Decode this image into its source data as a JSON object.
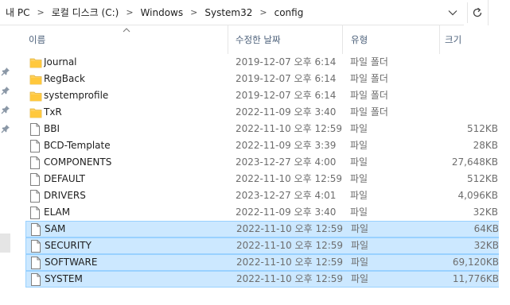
{
  "address_bar": {
    "crumbs": [
      "내 PC",
      "로컬 디스크 (C:)",
      "Windows",
      "System32",
      "config"
    ],
    "separator": ">"
  },
  "columns": {
    "name": "이름",
    "date": "수정한 날짜",
    "type": "유형",
    "size": "크기"
  },
  "rows": [
    {
      "name": "Journal",
      "date": "2019-12-07 오후 6:14",
      "type": "파일 폴더",
      "size": "",
      "icon": "folder-icon",
      "selected": false
    },
    {
      "name": "RegBack",
      "date": "2019-12-07 오후 6:14",
      "type": "파일 폴더",
      "size": "",
      "icon": "folder-icon",
      "selected": false
    },
    {
      "name": "systemprofile",
      "date": "2019-12-07 오후 6:14",
      "type": "파일 폴더",
      "size": "",
      "icon": "folder-icon",
      "selected": false
    },
    {
      "name": "TxR",
      "date": "2022-11-09 오후 3:40",
      "type": "파일 폴더",
      "size": "",
      "icon": "folder-icon",
      "selected": false
    },
    {
      "name": "BBI",
      "date": "2022-11-10 오후 12:59",
      "type": "파일",
      "size": "512KB",
      "icon": "file-icon",
      "selected": false
    },
    {
      "name": "BCD-Template",
      "date": "2022-11-09 오후 3:39",
      "type": "파일",
      "size": "28KB",
      "icon": "file-icon",
      "selected": false
    },
    {
      "name": "COMPONENTS",
      "date": "2023-12-27 오후 4:00",
      "type": "파일",
      "size": "27,648KB",
      "icon": "file-icon",
      "selected": false
    },
    {
      "name": "DEFAULT",
      "date": "2022-11-10 오후 12:59",
      "type": "파일",
      "size": "512KB",
      "icon": "file-icon",
      "selected": false
    },
    {
      "name": "DRIVERS",
      "date": "2023-12-27 오후 4:01",
      "type": "파일",
      "size": "4,096KB",
      "icon": "file-icon",
      "selected": false
    },
    {
      "name": "ELAM",
      "date": "2022-11-09 오후 3:40",
      "type": "파일",
      "size": "32KB",
      "icon": "file-icon",
      "selected": false
    },
    {
      "name": "SAM",
      "date": "2022-11-10 오후 12:59",
      "type": "파일",
      "size": "64KB",
      "icon": "file-icon",
      "selected": true
    },
    {
      "name": "SECURITY",
      "date": "2022-11-10 오후 12:59",
      "type": "파일",
      "size": "32KB",
      "icon": "file-icon",
      "selected": true
    },
    {
      "name": "SOFTWARE",
      "date": "2022-11-10 오후 12:59",
      "type": "파일",
      "size": "69,120KB",
      "icon": "file-icon",
      "selected": true
    },
    {
      "name": "SYSTEM",
      "date": "2022-11-10 오후 12:59",
      "type": "파일",
      "size": "11,776KB",
      "icon": "file-icon",
      "selected": true
    }
  ],
  "colors": {
    "selection_bg": "#cce8ff",
    "selection_border": "#99d1ff",
    "folder": "#ffd15c",
    "header_text": "#4c607a"
  }
}
